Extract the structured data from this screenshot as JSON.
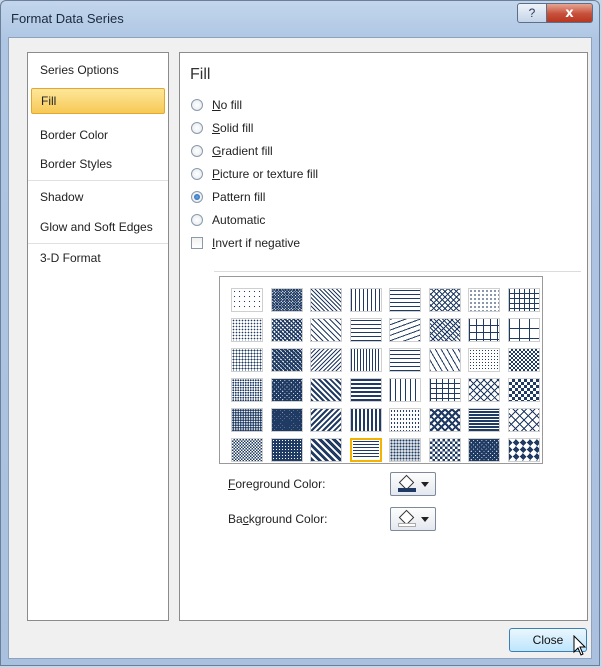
{
  "window": {
    "title": "Format Data Series",
    "help_label": "?",
    "close_label": "x"
  },
  "nav": {
    "items": [
      {
        "label": "Series Options",
        "selected": false
      },
      {
        "label": "Fill",
        "selected": true
      },
      {
        "label": "Border Color",
        "selected": false
      },
      {
        "label": "Border Styles",
        "selected": false
      },
      {
        "label": "Shadow",
        "selected": false
      },
      {
        "label": "Glow and Soft Edges",
        "selected": false
      },
      {
        "label": "3-D Format",
        "selected": false
      }
    ]
  },
  "panel": {
    "title": "Fill",
    "options": [
      {
        "key": "N",
        "rest": "o fill",
        "selected": false
      },
      {
        "key": "S",
        "rest": "olid fill",
        "selected": false
      },
      {
        "key": "G",
        "rest": "radient fill",
        "selected": false
      },
      {
        "key": "P",
        "rest": "icture or texture fill",
        "selected": false
      },
      {
        "key": "Pa",
        "rest": "ttern fill",
        "selected": true
      },
      {
        "key": "Au",
        "rest": "tomatic",
        "selected": false
      }
    ],
    "invert": {
      "key": "I",
      "rest": "nvert if negative",
      "checked": false
    },
    "pattern_grid": {
      "columns": 8,
      "rows": 6,
      "selected_index": 43
    },
    "foreground": {
      "label_key": "F",
      "label_rest": "oreground Color:",
      "color": "#1f3b63"
    },
    "background": {
      "label_pre": "Ba",
      "label_key": "c",
      "label_rest": "kground Color:",
      "color": "#ffffff"
    }
  },
  "footer": {
    "close_label": "Close"
  },
  "colors": {
    "pattern": "#1f3b63",
    "selected_nav": "#f7c955",
    "window_frame": "#aec6e3"
  }
}
